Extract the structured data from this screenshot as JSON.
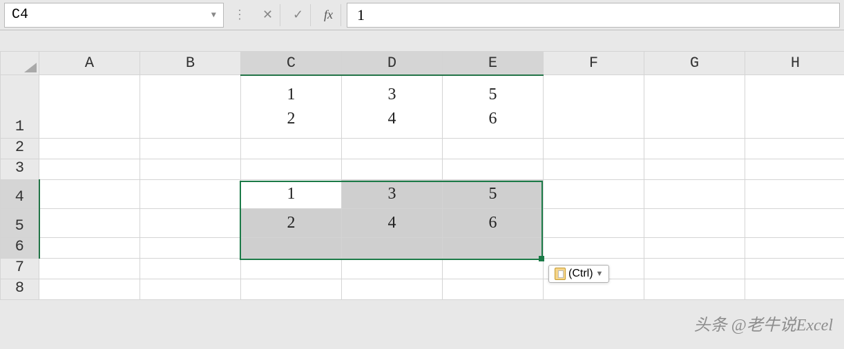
{
  "namebox": {
    "value": "C4"
  },
  "formula": {
    "value": "1"
  },
  "columns": [
    "A",
    "B",
    "C",
    "D",
    "E",
    "F",
    "G",
    "H"
  ],
  "selected_cols": [
    "C",
    "D",
    "E"
  ],
  "row_labels": [
    "1",
    "2",
    "3",
    "4",
    "5",
    "6",
    "7",
    "8"
  ],
  "selected_rows": [
    "4",
    "5",
    "6"
  ],
  "cells": {
    "r1": {
      "C_a": "1",
      "C_b": "2",
      "D_a": "3",
      "D_b": "4",
      "E_a": "5",
      "E_b": "6"
    },
    "r4": {
      "C": "1",
      "D": "3",
      "E": "5"
    },
    "r5": {
      "C": "2",
      "D": "4",
      "E": "6"
    }
  },
  "paste_options": {
    "label": "(Ctrl)"
  },
  "watermark": "头条 @老牛说Excel",
  "fb_icons": {
    "cancel": "✕",
    "confirm": "✓",
    "fx": "fx"
  }
}
